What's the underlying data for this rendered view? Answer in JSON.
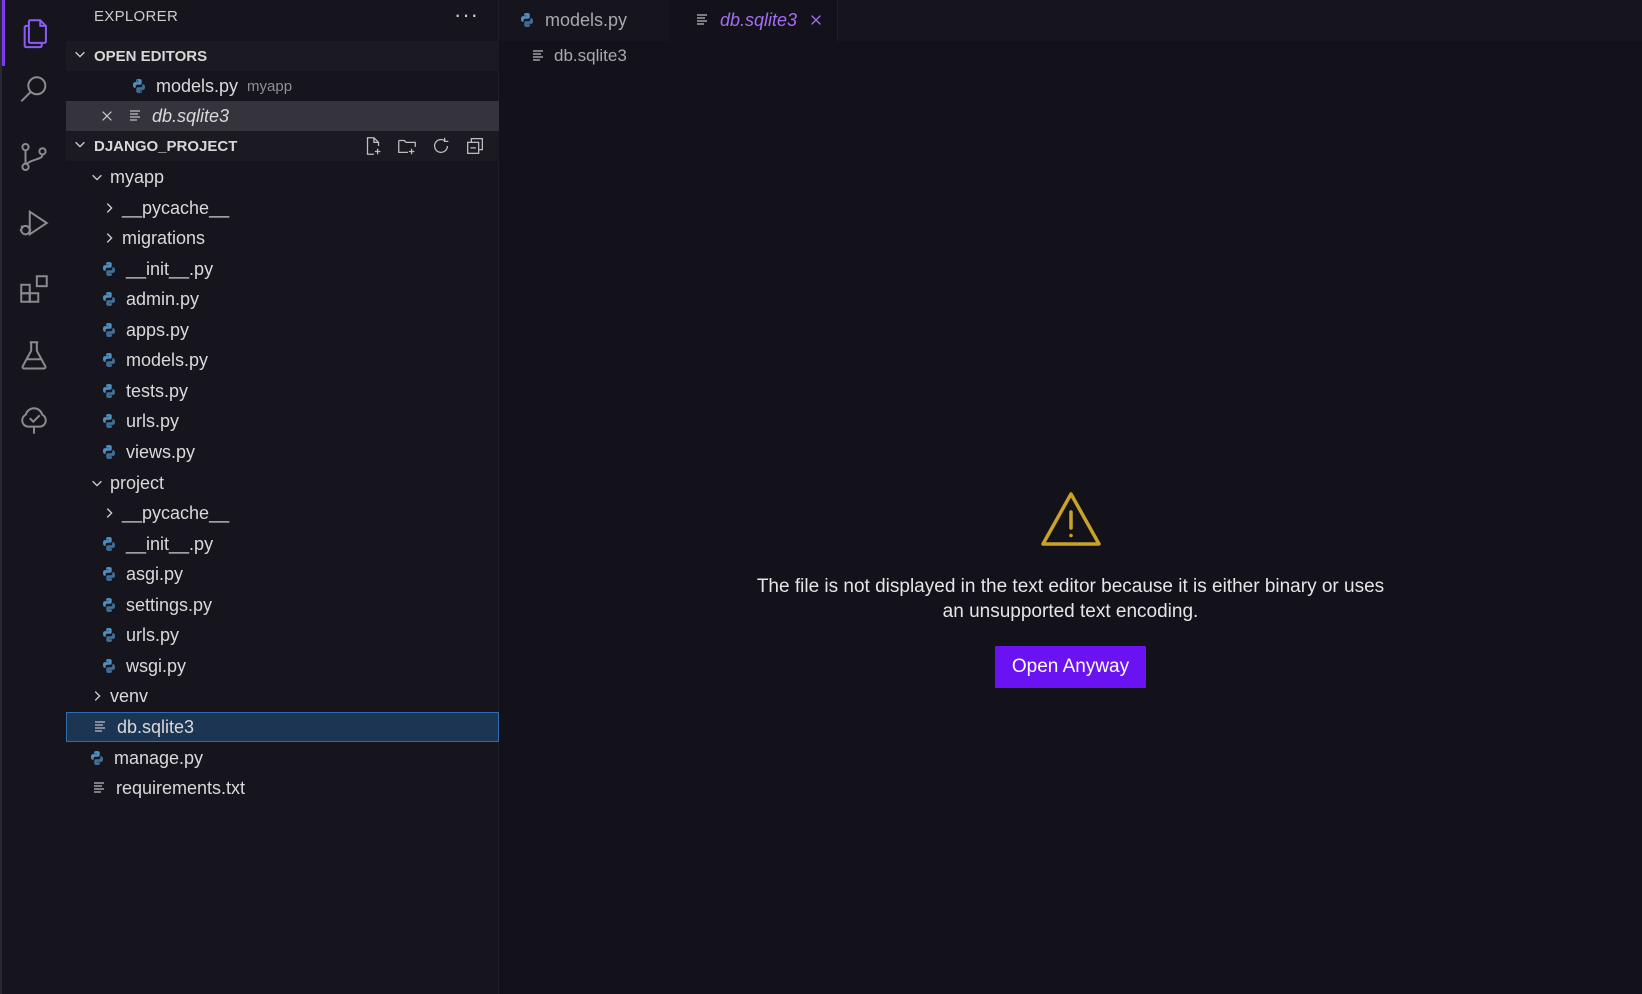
{
  "sidebar": {
    "title": "EXPLORER",
    "more": "···",
    "open_editors": {
      "label": "OPEN EDITORS",
      "items": [
        {
          "name": "models.py",
          "desc": "myapp"
        },
        {
          "name": "db.sqlite3",
          "desc": ""
        }
      ]
    },
    "project": {
      "label": "DJANGO_PROJECT",
      "tree": [
        {
          "label": "myapp"
        },
        {
          "label": "__pycache__"
        },
        {
          "label": "migrations"
        },
        {
          "label": "__init__.py"
        },
        {
          "label": "admin.py"
        },
        {
          "label": "apps.py"
        },
        {
          "label": "models.py"
        },
        {
          "label": "tests.py"
        },
        {
          "label": "urls.py"
        },
        {
          "label": "views.py"
        },
        {
          "label": "project"
        },
        {
          "label": "__pycache__"
        },
        {
          "label": "__init__.py"
        },
        {
          "label": "asgi.py"
        },
        {
          "label": "settings.py"
        },
        {
          "label": "urls.py"
        },
        {
          "label": "wsgi.py"
        },
        {
          "label": "venv"
        },
        {
          "label": "db.sqlite3"
        },
        {
          "label": "manage.py"
        },
        {
          "label": "requirements.txt"
        }
      ]
    }
  },
  "tabs": [
    {
      "label": "models.py"
    },
    {
      "label": "db.sqlite3"
    }
  ],
  "breadcrumb": {
    "file": "db.sqlite3"
  },
  "editor": {
    "message": "The file is not displayed in the text editor because it is either binary or uses an unsupported text encoding.",
    "button": "Open Anyway"
  },
  "colors": {
    "accent": "#7c3aed",
    "button": "#6b12f2",
    "warning": "#c9a227",
    "python_icon": "#4f8fc0"
  }
}
